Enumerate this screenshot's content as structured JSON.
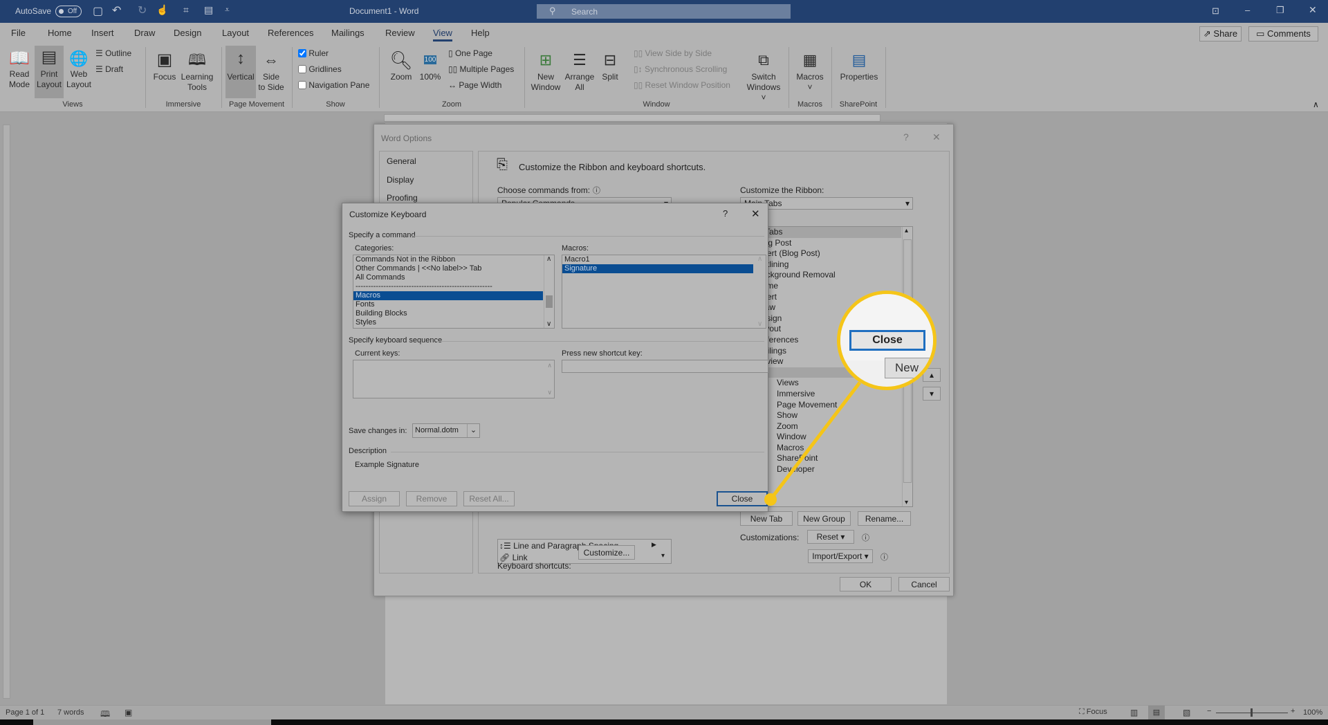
{
  "colors": {
    "title_bar": "#22406f",
    "selection": "#0a4d92",
    "highlight": "#f5c518",
    "focus_border": "#1f6fc0"
  },
  "titlebar": {
    "autosave_label": "AutoSave",
    "autosave_state": "Off",
    "document_title": "Document1 - Word",
    "search_placeholder": "Search"
  },
  "tabs": [
    "File",
    "Home",
    "Insert",
    "Draw",
    "Design",
    "Layout",
    "References",
    "Mailings",
    "Review",
    "View",
    "Help"
  ],
  "active_tab": "View",
  "share_label": "Share",
  "comments_label": "Comments",
  "ribbon": {
    "views": {
      "label": "Views",
      "read_mode": [
        "Read",
        "Mode"
      ],
      "print_layout": [
        "Print",
        "Layout"
      ],
      "web_layout": [
        "Web",
        "Layout"
      ],
      "outline": "Outline",
      "draft": "Draft"
    },
    "immersive": {
      "label": "Immersive",
      "focus": "Focus",
      "learning_tools": [
        "Learning",
        "Tools"
      ]
    },
    "page_movement": {
      "label": "Page Movement",
      "vertical": "Vertical",
      "side_to_side": [
        "Side",
        "to Side"
      ]
    },
    "show": {
      "label": "Show",
      "ruler": "Ruler",
      "ruler_checked": true,
      "gridlines": "Gridlines",
      "gridlines_checked": false,
      "navigation_pane": "Navigation Pane",
      "navigation_pane_checked": false
    },
    "zoom": {
      "label": "Zoom",
      "zoom": "Zoom",
      "hundred": "100%",
      "one_page": "One Page",
      "multiple_pages": "Multiple Pages",
      "page_width": "Page Width"
    },
    "window": {
      "label": "Window",
      "new_window": [
        "New",
        "Window"
      ],
      "arrange_all": [
        "Arrange",
        "All"
      ],
      "split": "Split",
      "view_side_by_side": "View Side by Side",
      "synchronous_scrolling": "Synchronous Scrolling",
      "reset_window_position": "Reset Window Position",
      "switch_windows": [
        "Switch",
        "Windows ˅"
      ]
    },
    "macros": {
      "label": "Macros",
      "macros": "Macros",
      "chevron": "˅"
    },
    "sharepoint": {
      "label": "SharePoint",
      "properties": "Properties"
    }
  },
  "word_options": {
    "title": "Word Options",
    "nav": [
      "General",
      "Display",
      "Proofing"
    ],
    "heading": "Customize the Ribbon and keyboard shortcuts.",
    "choose_commands_label": "Choose commands from:",
    "choose_commands_value": "Popular Commands",
    "commands": [
      "Line and Paragraph Spacing",
      "Link"
    ],
    "customize_ribbon_label": "Customize the Ribbon:",
    "customize_ribbon_value": "Main Tabs",
    "ribbon_tabs": [
      "Main Tabs",
      "Blog Post",
      "Insert (Blog Post)",
      "Outlining",
      "Background Removal",
      "Home",
      "Insert",
      "Draw",
      "Design",
      "Layout",
      "References",
      "Mailings",
      "Review",
      "View",
      "Views",
      "Immersive",
      "Page Movement",
      "Show",
      "Zoom",
      "Window",
      "Macros",
      "SharePoint",
      "Developer"
    ],
    "new_tab": "New Tab",
    "new_group": "New Group",
    "rename": "Rename...",
    "customizations_label": "Customizations:",
    "reset": "Reset ▾",
    "import_export": "Import/Export ▾",
    "keyboard_shortcuts_label": "Keyboard shortcuts:",
    "customize_button": "Customize...",
    "ok": "OK",
    "cancel": "Cancel",
    "help": "?",
    "close": "✕"
  },
  "customize_keyboard": {
    "title": "Customize Keyboard",
    "help": "?",
    "close": "✕",
    "specify_command": "Specify a command",
    "categories_label": "Categories:",
    "categories": [
      "Commands Not in the Ribbon",
      "Other Commands | <<No label>> Tab",
      "All Commands",
      "------------------------------------------------------",
      "Macros",
      "Fonts",
      "Building Blocks",
      "Styles"
    ],
    "selected_category": "Macros",
    "macros_label": "Macros:",
    "macros": [
      "Macro1",
      "Signature"
    ],
    "selected_macro": "Signature",
    "keyboard_sequence": "Specify keyboard sequence",
    "current_keys_label": "Current keys:",
    "new_shortcut_label": "Press new shortcut key:",
    "new_shortcut_value": "",
    "save_changes_label": "Save changes in:",
    "save_changes_value": "Normal.dotm",
    "description_label": "Description",
    "description": "Example Signature",
    "assign": "Assign",
    "remove": "Remove",
    "reset_all": "Reset All...",
    "close_button": "Close"
  },
  "callout": {
    "close": "Close",
    "new": "New"
  },
  "statusbar": {
    "page": "Page 1 of 1",
    "words": "7 words",
    "focus": "Focus",
    "zoom": "100%"
  }
}
